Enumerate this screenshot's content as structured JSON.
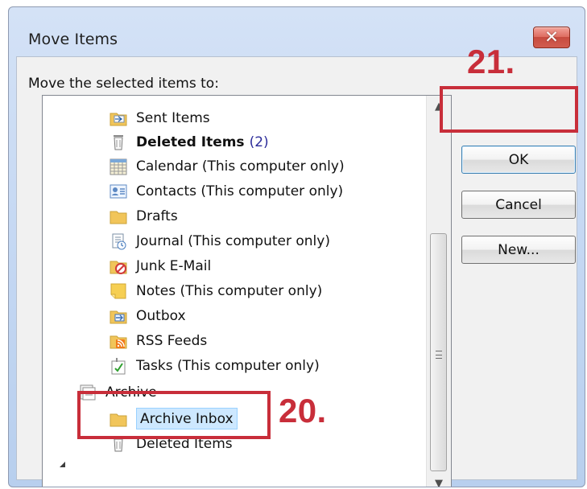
{
  "dialog": {
    "title": "Move Items",
    "prompt": "Move the selected items to:",
    "close_glyph": "✕"
  },
  "tree": {
    "items": [
      {
        "label": "Sent Items",
        "icon": "sent-items-icon"
      },
      {
        "label": "Deleted Items",
        "count": "(2)",
        "icon": "deleted-items-icon",
        "bold": true
      },
      {
        "label": "Calendar (This computer only)",
        "icon": "calendar-icon"
      },
      {
        "label": "Contacts (This computer only)",
        "icon": "contacts-icon"
      },
      {
        "label": "Drafts",
        "icon": "drafts-icon"
      },
      {
        "label": "Journal (This computer only)",
        "icon": "journal-icon"
      },
      {
        "label": "Junk E-Mail",
        "icon": "junk-email-icon"
      },
      {
        "label": "Notes (This computer only)",
        "icon": "notes-icon"
      },
      {
        "label": "Outbox",
        "icon": "outbox-icon"
      },
      {
        "label": "RSS Feeds",
        "icon": "rss-feeds-icon"
      },
      {
        "label": "Tasks (This computer only)",
        "icon": "tasks-icon"
      },
      {
        "label": "Archive",
        "icon": "archive-folder-icon",
        "expander": "collapse-triangle-icon"
      },
      {
        "label": "Archive Inbox",
        "icon": "archive-inbox-icon",
        "selected": true
      },
      {
        "label": "Deleted Items",
        "icon": "archive-deleted-items-icon"
      }
    ],
    "scroll_up_glyph": "▲",
    "scroll_down_glyph": "▼"
  },
  "buttons": {
    "ok": "OK",
    "cancel": "Cancel",
    "new": "New..."
  },
  "annotations": {
    "ok_step": "21.",
    "archive_step": "20.",
    "highlight_color": "#c82e3a"
  }
}
